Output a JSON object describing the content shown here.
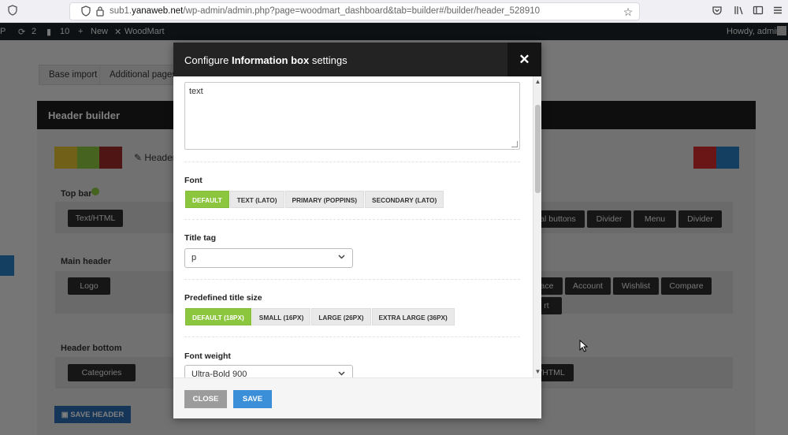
{
  "browser": {
    "url_prefix": "sub1.",
    "url_domain": "yanaweb.net",
    "url_path": "/wp-admin/admin.php?page=woodmart_dashboard&tab=builder#/builder/header_528910"
  },
  "wp_admin_bar": {
    "site_short": "P",
    "updates_count": "2",
    "comments_count": "10",
    "new_label": "New",
    "theme_label": "WoodMart",
    "greeting": "Howdy, admin"
  },
  "page": {
    "tabs": [
      "Base import",
      "Additional pages"
    ],
    "header_builder_title": "Header builder",
    "header_name_partial": "Header",
    "rows": {
      "top_bar": "Top bar",
      "main_header": "Main header",
      "header_bottom": "Header bottom"
    },
    "top_bar_items": [
      "Text/HTML",
      "al buttons",
      "Divider",
      "Menu",
      "Divider"
    ],
    "main_header_items": [
      "Logo",
      "ace",
      "Account",
      "Wishlist",
      "Compare",
      "rt"
    ],
    "header_bottom_items": [
      "Categories",
      "/HTML"
    ],
    "save_header_label": "SAVE HEADER"
  },
  "modal": {
    "title_prefix": "Configure ",
    "title_bold": "Information box",
    "title_suffix": " settings",
    "close_symbol": "✕",
    "textarea_value": "text",
    "font": {
      "label": "Font",
      "options": [
        "DEFAULT",
        "TEXT (LATO)",
        "PRIMARY (POPPINS)",
        "SECONDARY (LATO)"
      ],
      "selected": "DEFAULT"
    },
    "title_tag": {
      "label": "Title tag",
      "value": "p"
    },
    "title_size": {
      "label": "Predefined title size",
      "options": [
        "DEFAULT (18PX)",
        "SMALL (16PX)",
        "LARGE (26PX)",
        "EXTRA LARGE (36PX)"
      ],
      "selected": "DEFAULT (18PX)"
    },
    "font_weight": {
      "label": "Font weight",
      "value": "Ultra-Bold 900"
    },
    "buttons": {
      "close": "CLOSE",
      "save": "SAVE"
    }
  },
  "colors": {
    "accent_green": "#8cc63f",
    "save_blue": "#3b8fd9",
    "modal_header": "#232323"
  }
}
